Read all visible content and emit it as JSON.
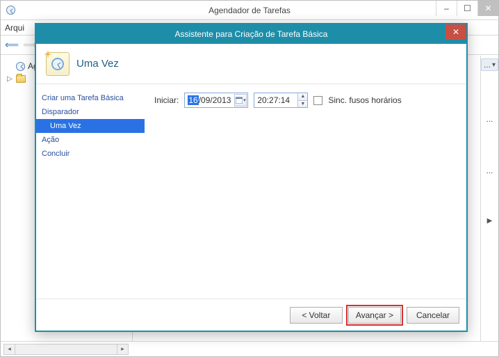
{
  "parent": {
    "title": "Agendador de Tarefas",
    "menu": {
      "file_truncated": "Arqui"
    },
    "tree": {
      "root_truncated": "Ag",
      "lib_expander": "▷"
    },
    "right_pane": {
      "ellipsis": "...",
      "arrow": "▾",
      "caret": "▶"
    }
  },
  "dialog": {
    "title": "Assistente para Criação de Tarefa Básica",
    "page_heading": "Uma Vez",
    "steps": {
      "s1": "Criar uma Tarefa Básica",
      "s2": "Disparador",
      "s2a": "Uma Vez",
      "s3": "Ação",
      "s4": "Concluir"
    },
    "form": {
      "start_label": "Iniciar:",
      "date_day_selected": "16",
      "date_rest": "/09/2013",
      "time_value": "20:27:14",
      "sync_tz_label": "Sinc. fusos horários"
    },
    "buttons": {
      "back": "< Voltar",
      "next": "Avançar >",
      "cancel": "Cancelar"
    }
  }
}
